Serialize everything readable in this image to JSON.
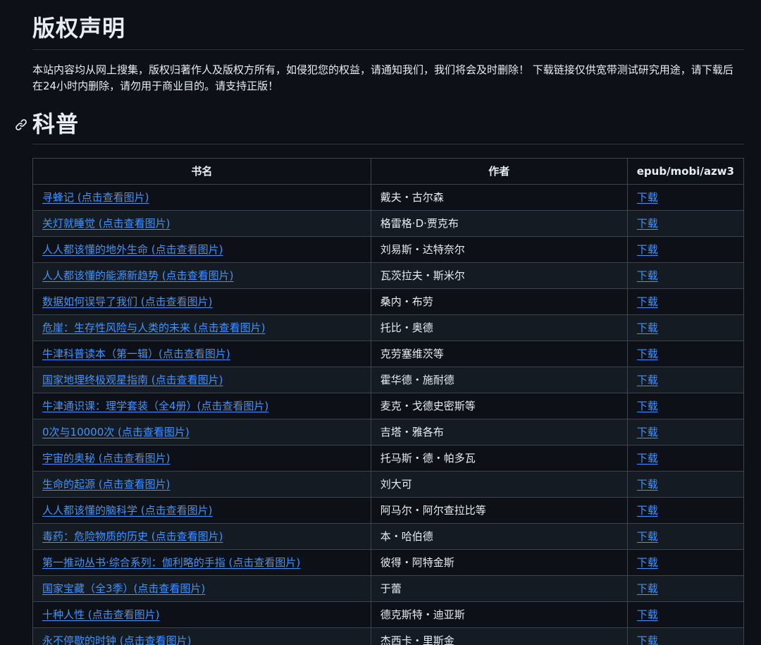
{
  "page": {
    "title": "版权声明",
    "notice": "本站内容均从网上搜集，版权归著作人及版权方所有，如侵犯您的权益，请通知我们，我们将会及时删除！ 下载链接仅供宽带测试研究用途，请下载后在24小时内删除，请勿用于商业目的。请支持正版！"
  },
  "section": {
    "heading": "科普",
    "anchor_icon": "link-icon"
  },
  "table": {
    "headers": [
      "书名",
      "作者",
      "epub/mobi/azw3"
    ],
    "rows": [
      {
        "title": "寻蜂记 (点击查看图片)",
        "author": "戴夫・古尔森",
        "download": "下载"
      },
      {
        "title": "关灯就睡觉 (点击查看图片)",
        "author": "格雷格·D·贾克布",
        "download": "下载"
      },
      {
        "title": "人人都该懂的地外生命 (点击查看图片)",
        "author": "刘易斯・达特奈尔",
        "download": "下载"
      },
      {
        "title": "人人都该懂的能源新趋势 (点击查看图片)",
        "author": "瓦茨拉夫・斯米尔",
        "download": "下载"
      },
      {
        "title": "数据如何误导了我们 (点击查看图片)",
        "author": "桑内・布劳",
        "download": "下载"
      },
      {
        "title": "危崖：生存性风险与人类的未来 (点击查看图片)",
        "author": "托比・奥德",
        "download": "下载"
      },
      {
        "title": "牛津科普读本（第一辑）(点击查看图片)",
        "author": "克劳塞维茨等",
        "download": "下载"
      },
      {
        "title": "国家地理终极观星指南 (点击查看图片)",
        "author": "霍华德・施耐德",
        "download": "下载"
      },
      {
        "title": "牛津通识课：理学套装（全4册）(点击查看图片)",
        "author": "麦克・戈德史密斯等",
        "download": "下载"
      },
      {
        "title": "0次与10000次 (点击查看图片)",
        "author": "吉塔・雅各布",
        "download": "下载"
      },
      {
        "title": "宇宙的奥秘 (点击查看图片)",
        "author": "托马斯・德・帕多瓦",
        "download": "下载"
      },
      {
        "title": "生命的起源 (点击查看图片)",
        "author": "刘大可",
        "download": "下载"
      },
      {
        "title": "人人都该懂的脑科学 (点击查看图片)",
        "author": "阿马尔・阿尔查拉比等",
        "download": "下载"
      },
      {
        "title": "毒药：危险物质的历史 (点击查看图片)",
        "author": "本・哈伯德",
        "download": "下载"
      },
      {
        "title": "第一推动丛书·综合系列：伽利略的手指 (点击查看图片)",
        "author": "彼得・阿特金斯",
        "download": "下载"
      },
      {
        "title": "国家宝藏（全3季）(点击查看图片)",
        "author": "于蕾",
        "download": "下载"
      },
      {
        "title": "十种人性 (点击查看图片)",
        "author": "德克斯特・迪亚斯",
        "download": "下载"
      },
      {
        "title": "永不停歇的时钟 (点击查看图片)",
        "author": "杰西卡・里斯金",
        "download": "下载"
      }
    ]
  },
  "colors": {
    "background": "#0d1117",
    "text": "#e6edf3",
    "link": "#4493f8",
    "border": "#3d444d",
    "row_alt": "#151b23"
  }
}
